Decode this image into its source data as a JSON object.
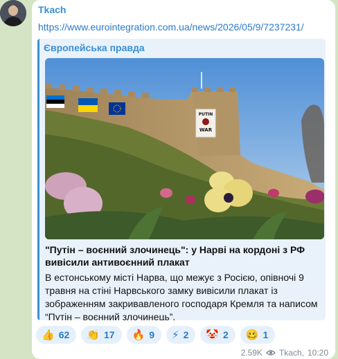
{
  "post": {
    "sender": "Tkach",
    "link": "https://www.eurointegration.com.ua/news/2026/05/9/7237231/",
    "preview": {
      "site_name": "Європейська правда",
      "image_alt": "Narva castle wall with a Putin War Criminal poster, flags and pansies",
      "poster_line1": "PUTIN",
      "poster_line2": "WAR",
      "title": "\"Путін – воєнний злочинець\": у Нарві на кордоні з РФ вивісили антивоєнний плакат",
      "description": "В естонському місті Нарва, що межує з Росією, опівночі 9 травня на стіні Нарвського замку вивісили плакат із зображенням закривавленого господаря Кремля та написом “Путін – воєнний злочинець”."
    },
    "reactions": [
      {
        "emoji": "👍",
        "icon": "thumbs-up",
        "count": "62"
      },
      {
        "emoji": "👏",
        "icon": "clapping-hands",
        "count": "17"
      },
      {
        "emoji": "🔥",
        "icon": "fire",
        "count": "9"
      },
      {
        "emoji": "⚡",
        "icon": "lightning",
        "count": "2"
      },
      {
        "emoji": "🤡",
        "icon": "clown",
        "count": "2"
      },
      {
        "emoji": "🥴",
        "icon": "woozy-face",
        "count": "1"
      }
    ],
    "views": "2.59K",
    "author_signature": "Tkach",
    "time": "10:20"
  },
  "colors": {
    "accent": "#3a8fd6",
    "chat_background": "#d4e4c4",
    "preview_background": "#e9f2fb"
  }
}
